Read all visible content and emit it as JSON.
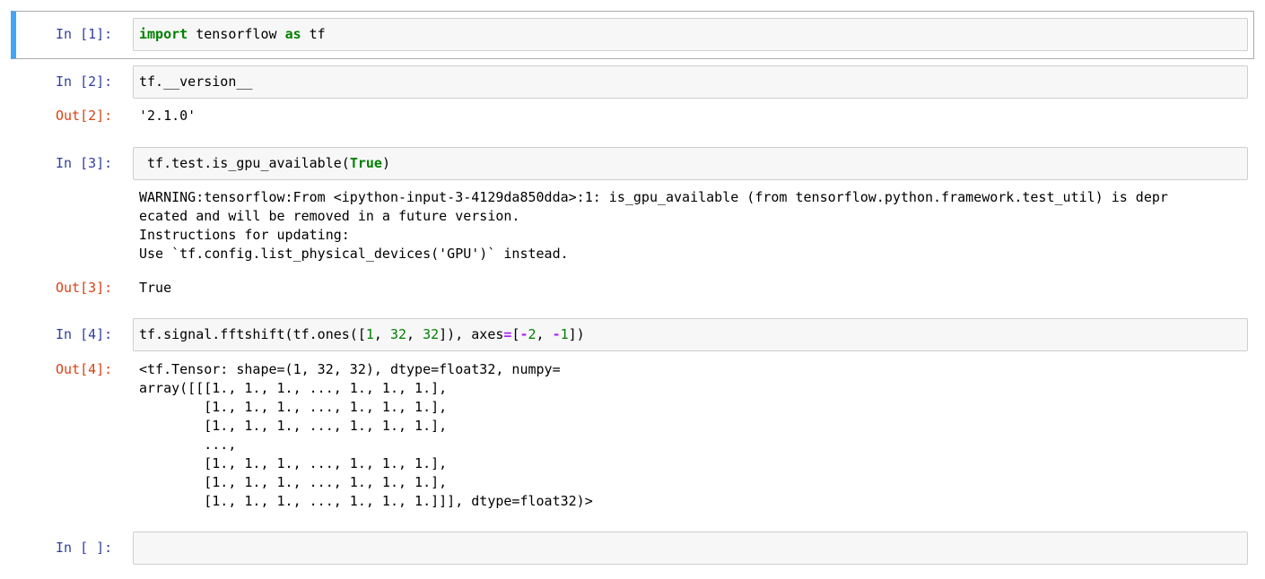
{
  "cells": [
    {
      "in_prompt": "In [1]:",
      "code": {
        "kw_import": "import",
        "mod": " tensorflow ",
        "kw_as": "as",
        "alias": " tf"
      }
    },
    {
      "in_prompt": "In [2]:",
      "code_text": "tf.__version__",
      "out_prompt": "Out[2]:",
      "output": "'2.1.0'"
    },
    {
      "in_prompt": "In [3]:",
      "code": {
        "pre": " tf.test.is_gpu_available(",
        "kw_true": "True",
        "post": ")"
      },
      "stderr": "WARNING:tensorflow:From <ipython-input-3-4129da850dda>:1: is_gpu_available (from tensorflow.python.framework.test_util) is depr\necated and will be removed in a future version.\nInstructions for updating:\nUse `tf.config.list_physical_devices('GPU')` instead.",
      "out_prompt": "Out[3]:",
      "output": "True"
    },
    {
      "in_prompt": "In [4]:",
      "code": {
        "p1": "tf.signal.fftshift(tf.ones([",
        "n1": "1",
        "p2": ", ",
        "n2": "32",
        "p3": ", ",
        "n3": "32",
        "p4": "]), axes",
        "eq": "=",
        "p5": "[",
        "minus1": "-",
        "n4": "2",
        "p6": ", ",
        "minus2": "-",
        "n5": "1",
        "p7": "])"
      },
      "out_prompt": "Out[4]:",
      "output": "<tf.Tensor: shape=(1, 32, 32), dtype=float32, numpy=\narray([[[1., 1., 1., ..., 1., 1., 1.],\n        [1., 1., 1., ..., 1., 1., 1.],\n        [1., 1., 1., ..., 1., 1., 1.],\n        ...,\n        [1., 1., 1., ..., 1., 1., 1.],\n        [1., 1., 1., ..., 1., 1., 1.],\n        [1., 1., 1., ..., 1., 1., 1.]]], dtype=float32)>"
    },
    {
      "in_prompt": "In [ ]:",
      "code_text": ""
    }
  ],
  "colors": {
    "selected_bar": "#42a5f5",
    "in_prompt": "#303f9f",
    "out_prompt": "#d84315",
    "keyword": "#008000",
    "operator": "#aa22ff"
  }
}
